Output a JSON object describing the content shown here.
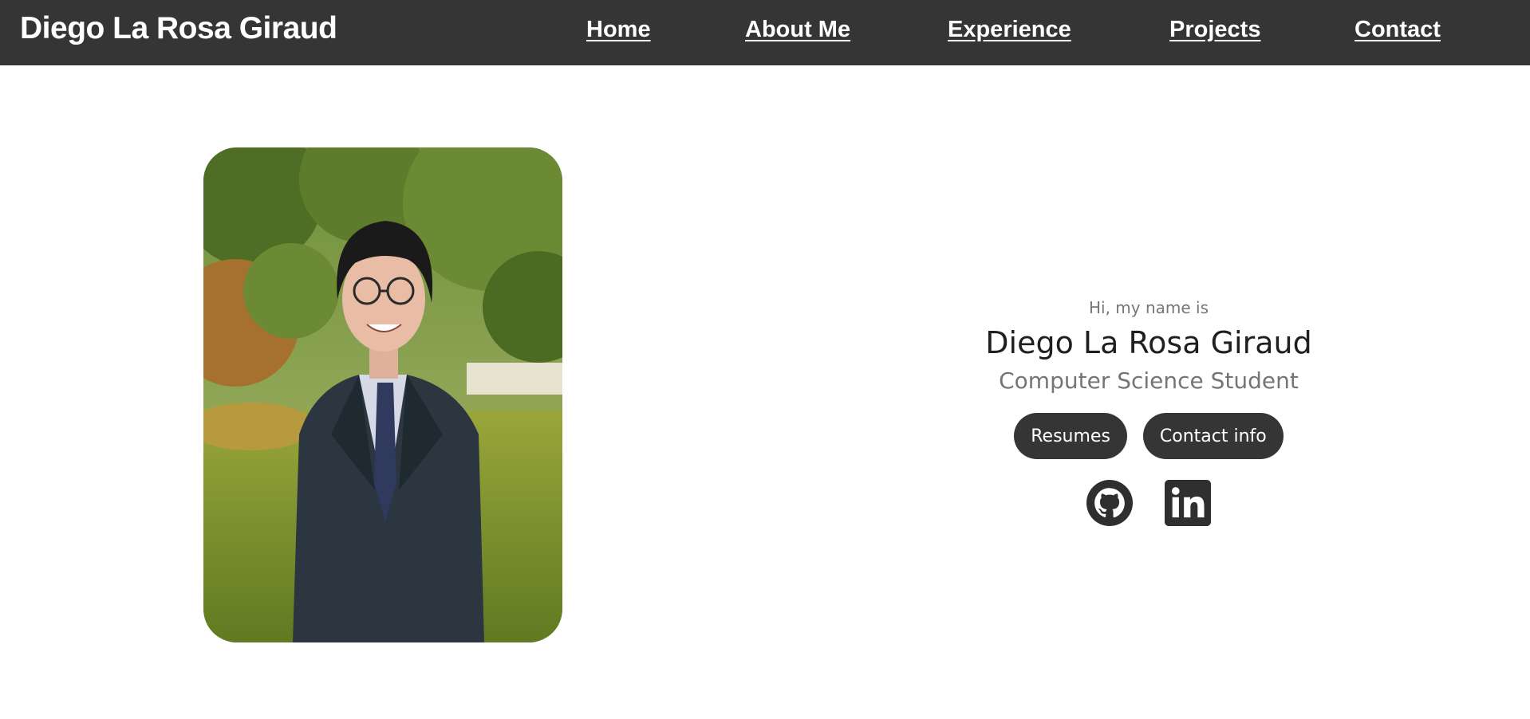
{
  "nav": {
    "brand": "Diego La Rosa Giraud",
    "links": [
      "Home",
      "About Me",
      "Experience",
      "Projects",
      "Contact"
    ]
  },
  "hero": {
    "greeting": "Hi, my name is",
    "name": "Diego La Rosa Giraud",
    "subtitle": "Computer Science Student",
    "buttons": [
      "Resumes",
      "Contact info"
    ],
    "socials": [
      "github-icon",
      "linkedin-icon"
    ]
  },
  "colors": {
    "nav_bg": "#353535",
    "button_bg": "#353535",
    "muted_text": "#757575"
  }
}
